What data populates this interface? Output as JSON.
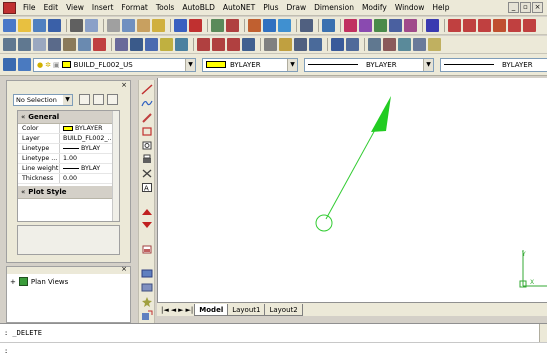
{
  "menubar": {
    "items": [
      "File",
      "Edit",
      "View",
      "Insert",
      "Format",
      "Tools",
      "AutoBLD",
      "AutoNET",
      "Plus",
      "Draw",
      "Dimension",
      "Modify",
      "Window",
      "Help"
    ],
    "win_min": "_",
    "win_max": "▫",
    "win_close": "×"
  },
  "properties_bar": {
    "layer_value": "BUILD_FL002_US",
    "color_value": "BYLAYER",
    "linetype_value": "BYLAYER",
    "lineweight_value": "BYLAYER"
  },
  "palette": {
    "close": "×",
    "selection": "No Selection",
    "general_header": "General",
    "general_rows": [
      {
        "key": "Color",
        "value": "BYLAYER",
        "kind": "swatch"
      },
      {
        "key": "Layer",
        "value": "BUILD_FL002_..."
      },
      {
        "key": "Linetype",
        "value": "BYLAY",
        "kind": "line"
      },
      {
        "key": "Linetype ...",
        "value": "1.00"
      },
      {
        "key": "Line weight",
        "value": "BYLAY",
        "kind": "line"
      },
      {
        "key": "Thickness",
        "value": "0.00"
      }
    ],
    "plot_header": "Plot Style"
  },
  "planviews": {
    "close": "×",
    "item": "Plan Views",
    "expander": "+"
  },
  "tabs": {
    "nav": [
      "|◄",
      "◄",
      "►",
      "►|"
    ],
    "items": [
      "Model",
      "Layout1",
      "Layout2"
    ],
    "active": "Model"
  },
  "command": {
    "line1": ": _DELETE",
    "line2": ":"
  },
  "colors": {
    "arrow": "#33cc33",
    "ucs": "#33aa33"
  }
}
